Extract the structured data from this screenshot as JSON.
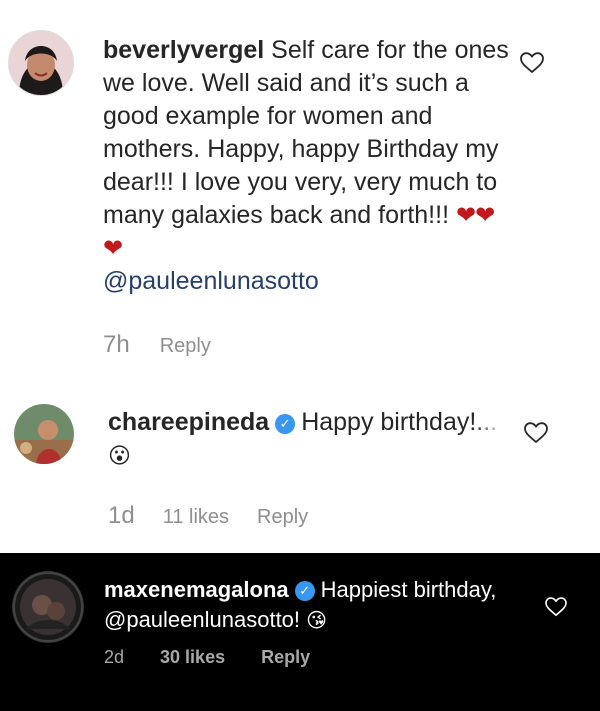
{
  "comments": [
    {
      "username": "beverlyvergel",
      "text": "Self care for the ones we love. Well said and it’s such a good example for women and mothers. Happy, happy Birthday my dear!!! I love you very, very much to many galaxies back and forth!!!",
      "hearts": "❤❤❤",
      "mention": "@pauleenlunasotto",
      "time": "7h",
      "reply_label": "Reply"
    },
    {
      "username": "chareepineda",
      "text": "Happy birthd",
      "fade_text": "ay!...",
      "emoji": "😮",
      "time": "1d",
      "likes": "11 likes",
      "reply_label": "Reply"
    },
    {
      "username": "maxenemagalona",
      "text": "Happiest birthday,",
      "mention": "@pauleenlunasotto!",
      "emoji": "😘",
      "time": "2d",
      "likes": "30 likes",
      "reply_label": "Reply"
    }
  ],
  "icons": {
    "like": "heart-outline-icon",
    "verified": "verified-badge-icon"
  },
  "colors": {
    "mention": "#283e6b",
    "meta": "#8e8e8e",
    "verified": "#3897f0",
    "dark_bg": "#000000"
  }
}
